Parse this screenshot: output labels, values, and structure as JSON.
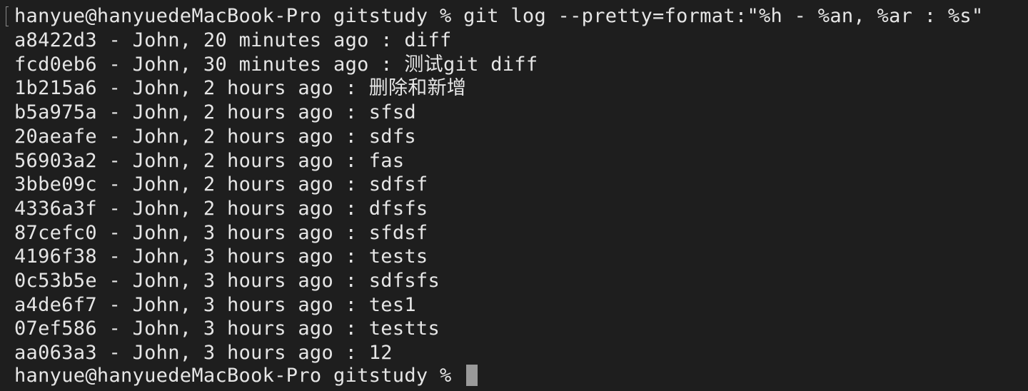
{
  "terminal": {
    "command_line": {
      "prompt": "hanyue@hanyuedeMacBook-Pro gitstudy % ",
      "command": "git log --pretty=format:\"%h - %an, %ar : %s\""
    },
    "log_entries": [
      {
        "hash": "a8422d3",
        "author": "John",
        "time": "20 minutes ago",
        "subject": "diff"
      },
      {
        "hash": "fcd0eb6",
        "author": "John",
        "time": "30 minutes ago",
        "subject": "测试git diff"
      },
      {
        "hash": "1b215a6",
        "author": "John",
        "time": "2 hours ago",
        "subject": "删除和新增"
      },
      {
        "hash": "b5a975a",
        "author": "John",
        "time": "2 hours ago",
        "subject": "sfsd"
      },
      {
        "hash": "20aeafe",
        "author": "John",
        "time": "2 hours ago",
        "subject": "sdfs"
      },
      {
        "hash": "56903a2",
        "author": "John",
        "time": "2 hours ago",
        "subject": "fas"
      },
      {
        "hash": "3bbe09c",
        "author": "John",
        "time": "2 hours ago",
        "subject": "sdfsf"
      },
      {
        "hash": "4336a3f",
        "author": "John",
        "time": "2 hours ago",
        "subject": "dfsfs"
      },
      {
        "hash": "87cefc0",
        "author": "John",
        "time": "3 hours ago",
        "subject": "sfdsf"
      },
      {
        "hash": "4196f38",
        "author": "John",
        "time": "3 hours ago",
        "subject": "tests"
      },
      {
        "hash": "0c53b5e",
        "author": "John",
        "time": "3 hours ago",
        "subject": "sdfsfs"
      },
      {
        "hash": "a4de6f7",
        "author": "John",
        "time": "3 hours ago",
        "subject": "tes1"
      },
      {
        "hash": "07ef586",
        "author": "John",
        "time": "3 hours ago",
        "subject": "testts"
      },
      {
        "hash": "aa063a3",
        "author": "John",
        "time": "3 hours ago",
        "subject": "12"
      }
    ],
    "final_prompt": "hanyue@hanyuedeMacBook-Pro gitstudy % ",
    "colors": {
      "background": "#1e1e1e",
      "text": "#e6e6e6",
      "cursor": "#9a9a9a"
    }
  }
}
